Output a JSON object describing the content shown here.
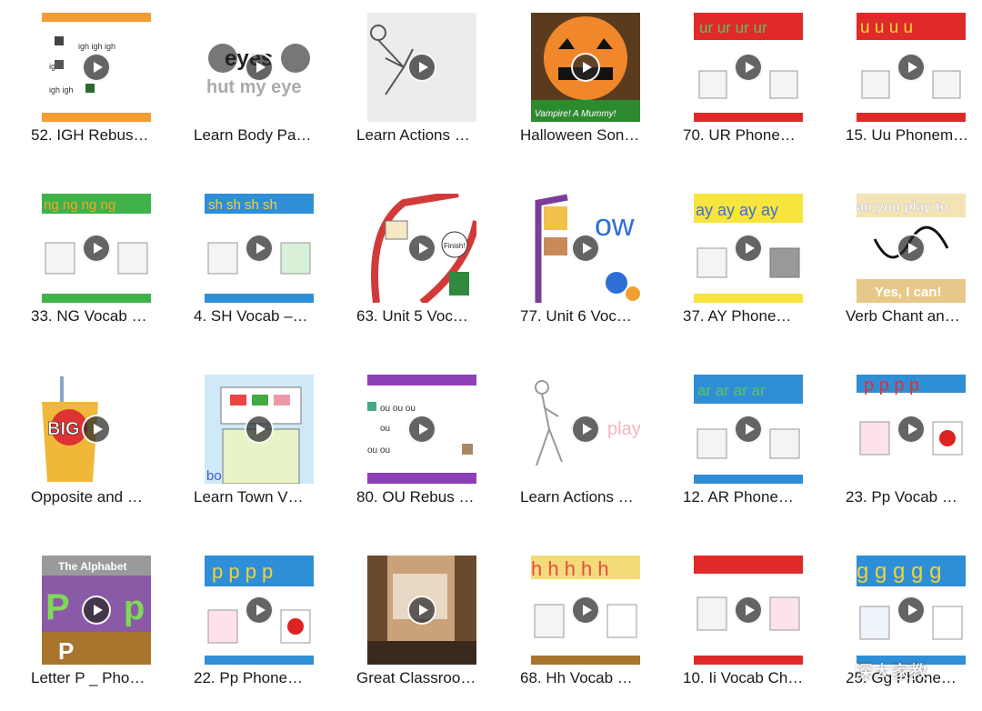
{
  "videos": [
    {
      "title": "52. IGH Rebus…",
      "icon": "play-icon"
    },
    {
      "title": "Learn Body Pa…",
      "icon": "play-icon"
    },
    {
      "title": "Learn Actions …",
      "icon": "play-icon"
    },
    {
      "title": "Halloween Son…",
      "icon": "play-icon"
    },
    {
      "title": "70. UR Phone…",
      "icon": "play-icon"
    },
    {
      "title": "15. Uu Phonem…",
      "icon": "play-icon"
    },
    {
      "title": "33. NG Vocab …",
      "icon": "play-icon"
    },
    {
      "title": "4. SH Vocab –…",
      "icon": "play-icon"
    },
    {
      "title": "63. Unit 5 Voc…",
      "icon": "play-icon"
    },
    {
      "title": "77. Unit 6 Voc…",
      "icon": "play-icon"
    },
    {
      "title": "37. AY Phone…",
      "icon": "play-icon"
    },
    {
      "title": "Verb Chant an…",
      "icon": "play-icon"
    },
    {
      "title": "Opposite and …",
      "icon": "play-icon"
    },
    {
      "title": "Learn Town V…",
      "icon": "play-icon"
    },
    {
      "title": "80. OU Rebus …",
      "icon": "play-icon"
    },
    {
      "title": "Learn Actions …",
      "icon": "play-icon"
    },
    {
      "title": "12. AR Phone…",
      "icon": "play-icon"
    },
    {
      "title": "23. Pp Vocab …",
      "icon": "play-icon"
    },
    {
      "title": "Letter P _ Pho…",
      "icon": "play-icon"
    },
    {
      "title": "22. Pp Phone…",
      "icon": "play-icon"
    },
    {
      "title": "Great Classroo…",
      "icon": "play-icon"
    },
    {
      "title": "68. Hh Vocab …",
      "icon": "play-icon"
    },
    {
      "title": "10. Ii Vocab Ch…",
      "icon": "play-icon"
    },
    {
      "title": "25. Gg Phone…",
      "icon": "play-icon"
    }
  ],
  "thumb_text": {
    "t0": "igh igh igh",
    "t1a": "eyes",
    "t1b": "hut my eye",
    "t3": "Vampire! A Mummy!",
    "t4": "ur ur ur ur",
    "t5": "u u u u",
    "t6": "ng ng ng ng",
    "t7": "sh sh sh sh",
    "t8": "Finish!",
    "t9": "ow",
    "t10": "ay ay ay ay",
    "t11a": "an you play to",
    "t11b": "Yes, I can!",
    "t12": "BIG",
    "t13": "bo",
    "t14": "ou ou ou",
    "t15": "play",
    "t16": "ar ar ar ar",
    "t17": "p p p p",
    "t18a": "The Alphabet",
    "t18b": "P",
    "t18c": "p",
    "t18d": "P",
    "t19": "p p p p",
    "t21": "h h h h h",
    "t23": "g g g g g"
  },
  "watermark": {
    "text": "深大家教",
    "icon": "wechat-icon"
  }
}
